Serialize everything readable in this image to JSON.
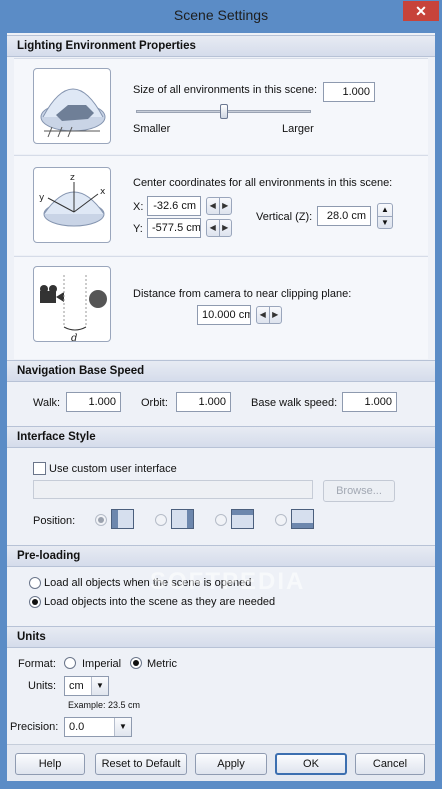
{
  "window": {
    "title": "Scene Settings",
    "close_glyph": "✕"
  },
  "lighting": {
    "header": "Lighting Environment Properties",
    "size_label": "Size of all environments in this scene:",
    "size_value": "1.000",
    "slider_min_label": "Smaller",
    "slider_max_label": "Larger",
    "slider_level": 0.5,
    "center_label": "Center coordinates for all environments in this scene:",
    "x_label": "X:",
    "x_value": "-32.6 cm",
    "y_label": "Y:",
    "y_value": "-577.5 cm",
    "vertical_label": "Vertical (Z):",
    "vertical_value": "28.0 cm",
    "clip_label": "Distance from camera to near clipping plane:",
    "clip_value": "10.000 cm",
    "axis_x": "x",
    "axis_y": "y",
    "axis_z": "z",
    "clip_symbol": "d"
  },
  "navigation": {
    "header": "Navigation Base Speed",
    "walk_label": "Walk:",
    "walk_value": "1.000",
    "orbit_label": "Orbit:",
    "orbit_value": "1.000",
    "base_label": "Base walk speed:",
    "base_value": "1.000"
  },
  "interface": {
    "header": "Interface Style",
    "custom_label": "Use custom user interface",
    "path_value": "",
    "browse_label": "Browse...",
    "position_label": "Position:"
  },
  "preloading": {
    "header": "Pre-loading",
    "option_all": "Load all objects when the scene is opened",
    "option_needed": "Load objects into the scene as they are needed"
  },
  "units": {
    "header": "Units",
    "format_label": "Format:",
    "imperial_label": "Imperial",
    "metric_label": "Metric",
    "units_label": "Units:",
    "units_value": "cm",
    "example_text": "Example: 23.5 cm",
    "precision_label": "Precision:",
    "precision_value": "0.0"
  },
  "buttons": {
    "help": "Help",
    "reset": "Reset to Default",
    "apply": "Apply",
    "ok": "OK",
    "cancel": "Cancel"
  },
  "icons": {
    "spin_left": "◀",
    "spin_right": "▶",
    "spin_up": "▲",
    "spin_down": "▼",
    "dropdown": "▼"
  },
  "watermark": "SOFTPEDIA"
}
